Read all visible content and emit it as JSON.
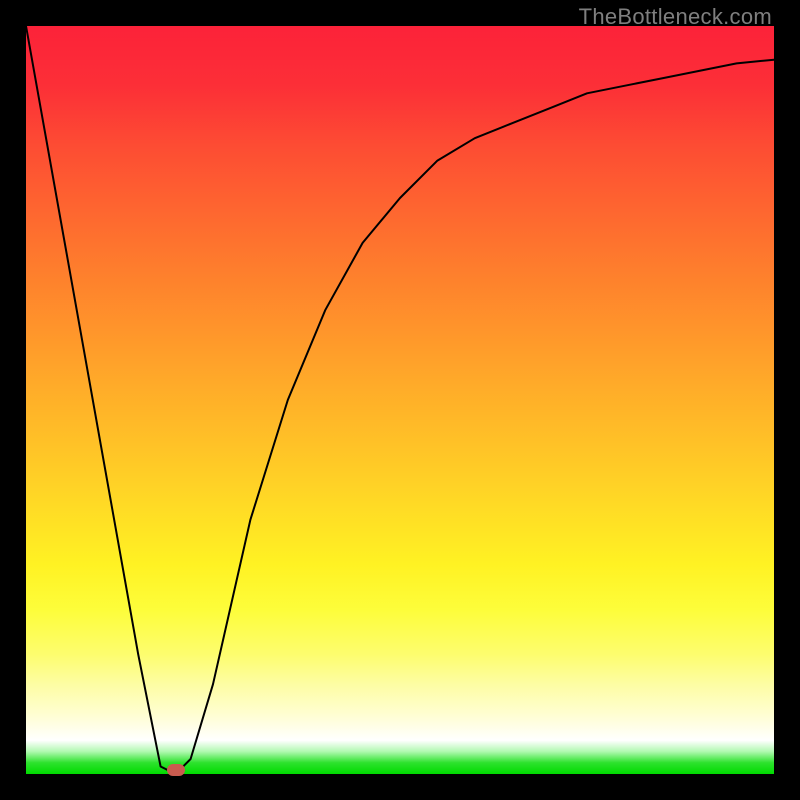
{
  "watermark": "TheBottleneck.com",
  "chart_data": {
    "type": "line",
    "title": "",
    "xlabel": "",
    "ylabel": "",
    "background": "gradient-heatmap",
    "x": [
      0.0,
      0.05,
      0.1,
      0.15,
      0.18,
      0.2,
      0.22,
      0.25,
      0.3,
      0.35,
      0.4,
      0.45,
      0.5,
      0.55,
      0.6,
      0.65,
      0.7,
      0.75,
      0.8,
      0.85,
      0.9,
      0.95,
      1.0
    ],
    "values": [
      1.0,
      0.72,
      0.44,
      0.16,
      0.01,
      0.0,
      0.02,
      0.12,
      0.34,
      0.5,
      0.62,
      0.71,
      0.77,
      0.82,
      0.85,
      0.87,
      0.89,
      0.91,
      0.92,
      0.93,
      0.94,
      0.95,
      0.955
    ],
    "minimum_marker": {
      "x": 0.2,
      "y": 0.0
    },
    "xlim": [
      0,
      1
    ],
    "ylim": [
      0,
      1
    ]
  }
}
